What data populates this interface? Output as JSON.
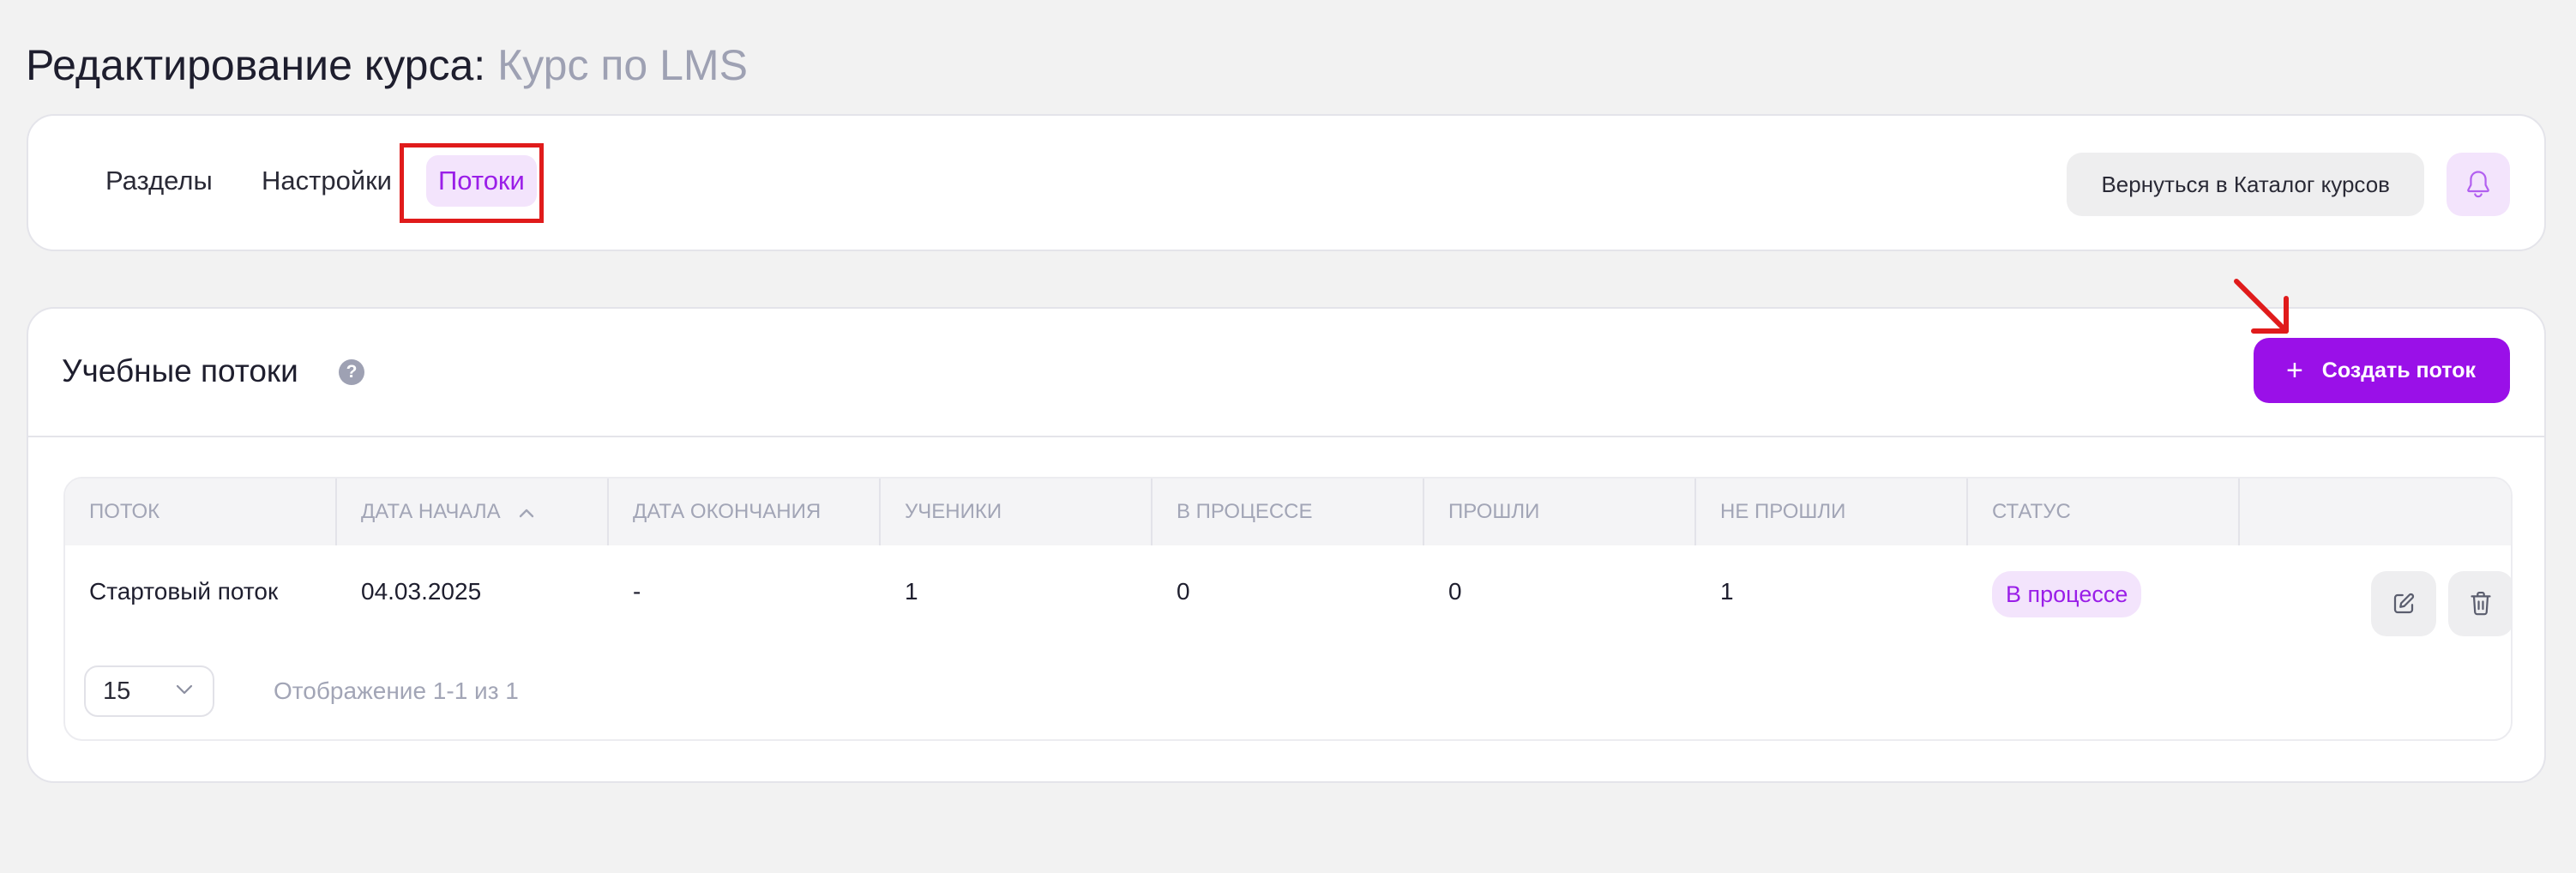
{
  "page": {
    "title_prefix": "Редактирование курса:",
    "course_name": "Курс по LMS"
  },
  "tabs": [
    {
      "label": "Разделы",
      "active": false
    },
    {
      "label": "Настройки",
      "active": false
    },
    {
      "label": "Потоки",
      "active": true
    }
  ],
  "header_actions": {
    "back_label": "Вернуться в Каталог курсов",
    "bell_icon": "bell-icon"
  },
  "streams": {
    "title": "Учебные потоки",
    "help_icon": "?",
    "create_label": "Создать поток",
    "create_icon": "+",
    "columns": [
      "ПОТОК",
      "ДАТА НАЧАЛА",
      "ДАТА ОКОНЧАНИЯ",
      "УЧЕНИКИ",
      "В ПРОЦЕССЕ",
      "ПРОШЛИ",
      "НЕ ПРОШЛИ",
      "СТАТУС"
    ],
    "sorted_column": "ДАТА НАЧАЛА",
    "sort_direction": "ascending",
    "rows": [
      {
        "name": "Стартовый поток",
        "start_date": "04.03.2025",
        "end_date": "-",
        "students": "1",
        "in_progress": "0",
        "passed": "0",
        "failed": "1",
        "status": "В процессе"
      }
    ],
    "per_page": "15",
    "pagination_info": "Отображение 1-1 из 1"
  },
  "colors": {
    "accent": "#9a10e8",
    "accent_light": "#f3e4fc",
    "annotation": "#e01b1b",
    "muted_text": "#a2a5b6",
    "background": "#f2f2f2"
  }
}
